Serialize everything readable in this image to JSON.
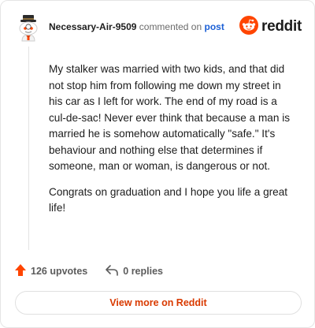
{
  "header": {
    "username": "Necessary-Air-9509",
    "commented_text": "commented on",
    "post_link": "post",
    "logo_text": "reddit"
  },
  "comment": {
    "paragraphs": [
      "My stalker was married with two kids, and that did not stop him from following me down my street in his car as I left for work. The end of my road is a cul-de-sac! Never ever think that because a man is married he is somehow automatically \"safe.\" It's behaviour and nothing else that determines if someone, man or woman, is dangerous or not.",
      "Congrats on graduation and I hope you life a great life!"
    ]
  },
  "actions": {
    "upvotes": "126 upvotes",
    "replies": "0 replies"
  },
  "footer": {
    "view_more": "View more on Reddit"
  },
  "colors": {
    "brand": "#ff4500",
    "upvote": "#ff4500",
    "link": "#1c60d6",
    "view_more_text": "#d93a00"
  },
  "icons": {
    "avatar": "snoo-avatar-icon",
    "logo": "reddit-logo-icon",
    "upvote": "upvote-arrow-icon",
    "reply": "reply-arrow-icon"
  }
}
